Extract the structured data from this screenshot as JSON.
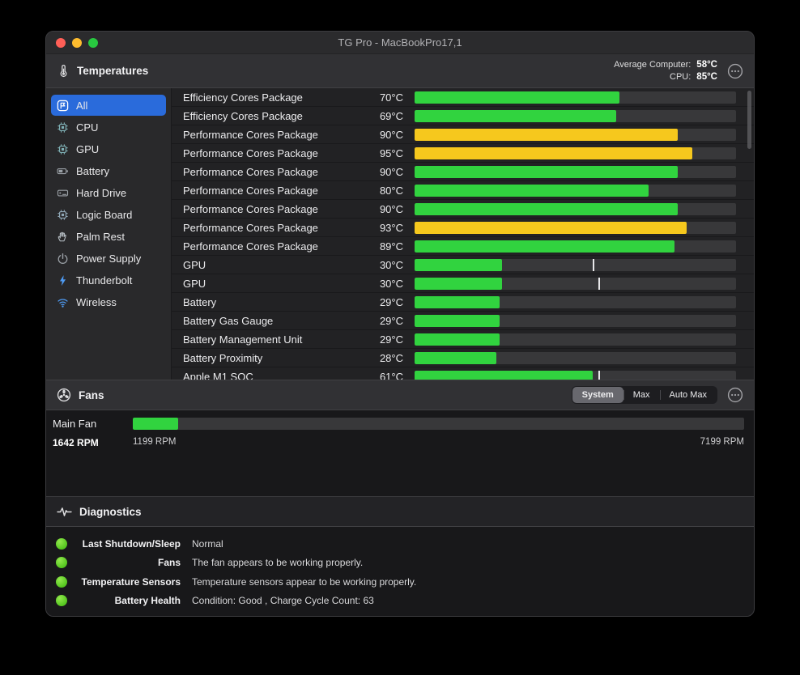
{
  "window": {
    "title": "TG Pro - MacBookPro17,1"
  },
  "colors": {
    "green": "#31d33f",
    "yellow": "#f6c81d",
    "selection_blue": "#2a6bdb",
    "diagnostic_ok_green": "#54c61f"
  },
  "temperatures": {
    "section_title": "Temperatures",
    "summary": {
      "average_label": "Average Computer:",
      "average_value": "58°C",
      "cpu_label": "CPU:",
      "cpu_value": "85°C"
    },
    "sidebar": [
      {
        "label": "All",
        "selected": true
      },
      {
        "label": "CPU",
        "selected": false
      },
      {
        "label": "GPU",
        "selected": false
      },
      {
        "label": "Battery",
        "selected": false
      },
      {
        "label": "Hard Drive",
        "selected": false
      },
      {
        "label": "Logic Board",
        "selected": false
      },
      {
        "label": "Palm Rest",
        "selected": false
      },
      {
        "label": "Power Supply",
        "selected": false
      },
      {
        "label": "Thunderbolt",
        "selected": false
      },
      {
        "label": "Wireless",
        "selected": false
      }
    ],
    "scale_max": 110,
    "rows": [
      {
        "name": "Efficiency Cores Package",
        "value": "70°C",
        "temp": 70,
        "color": "green",
        "tick": null
      },
      {
        "name": "Efficiency Cores Package",
        "value": "69°C",
        "temp": 69,
        "color": "green",
        "tick": null
      },
      {
        "name": "Performance Cores Package",
        "value": "90°C",
        "temp": 90,
        "color": "yellow",
        "tick": null
      },
      {
        "name": "Performance Cores Package",
        "value": "95°C",
        "temp": 95,
        "color": "yellow",
        "tick": null
      },
      {
        "name": "Performance Cores Package",
        "value": "90°C",
        "temp": 90,
        "color": "green",
        "tick": null
      },
      {
        "name": "Performance Cores Package",
        "value": "80°C",
        "temp": 80,
        "color": "green",
        "tick": null
      },
      {
        "name": "Performance Cores Package",
        "value": "90°C",
        "temp": 90,
        "color": "green",
        "tick": null
      },
      {
        "name": "Performance Cores Package",
        "value": "93°C",
        "temp": 93,
        "color": "yellow",
        "tick": null
      },
      {
        "name": "Performance Cores Package",
        "value": "89°C",
        "temp": 89,
        "color": "green",
        "tick": null
      },
      {
        "name": "GPU",
        "value": "30°C",
        "temp": 30,
        "color": "green",
        "tick": 61
      },
      {
        "name": "GPU",
        "value": "30°C",
        "temp": 30,
        "color": "green",
        "tick": 63
      },
      {
        "name": "Battery",
        "value": "29°C",
        "temp": 29,
        "color": "green",
        "tick": null
      },
      {
        "name": "Battery Gas Gauge",
        "value": "29°C",
        "temp": 29,
        "color": "green",
        "tick": null
      },
      {
        "name": "Battery Management Unit",
        "value": "29°C",
        "temp": 29,
        "color": "green",
        "tick": null
      },
      {
        "name": "Battery Proximity",
        "value": "28°C",
        "temp": 28,
        "color": "green",
        "tick": null
      },
      {
        "name": "Apple M1 SOC",
        "value": "61°C",
        "temp": 61,
        "color": "green",
        "tick": 63
      }
    ]
  },
  "fans": {
    "section_title": "Fans",
    "modes": [
      {
        "label": "System",
        "selected": true
      },
      {
        "label": "Max",
        "selected": false
      },
      {
        "label": "Auto Max",
        "selected": false
      }
    ],
    "main_fan": {
      "name": "Main Fan",
      "current_label": "1642 RPM",
      "current_rpm": 1642,
      "min_label": "1199 RPM",
      "min_rpm": 1199,
      "max_label": "7199 RPM",
      "max_rpm": 7199
    }
  },
  "diagnostics": {
    "section_title": "Diagnostics",
    "items": [
      {
        "label": "Last Shutdown/Sleep",
        "status": "Normal"
      },
      {
        "label": "Fans",
        "status": "The fan appears to be working properly."
      },
      {
        "label": "Temperature Sensors",
        "status": "Temperature sensors appear to be working properly."
      },
      {
        "label": "Battery Health",
        "status": "Condition: Good , Charge Cycle Count: 63"
      }
    ]
  }
}
